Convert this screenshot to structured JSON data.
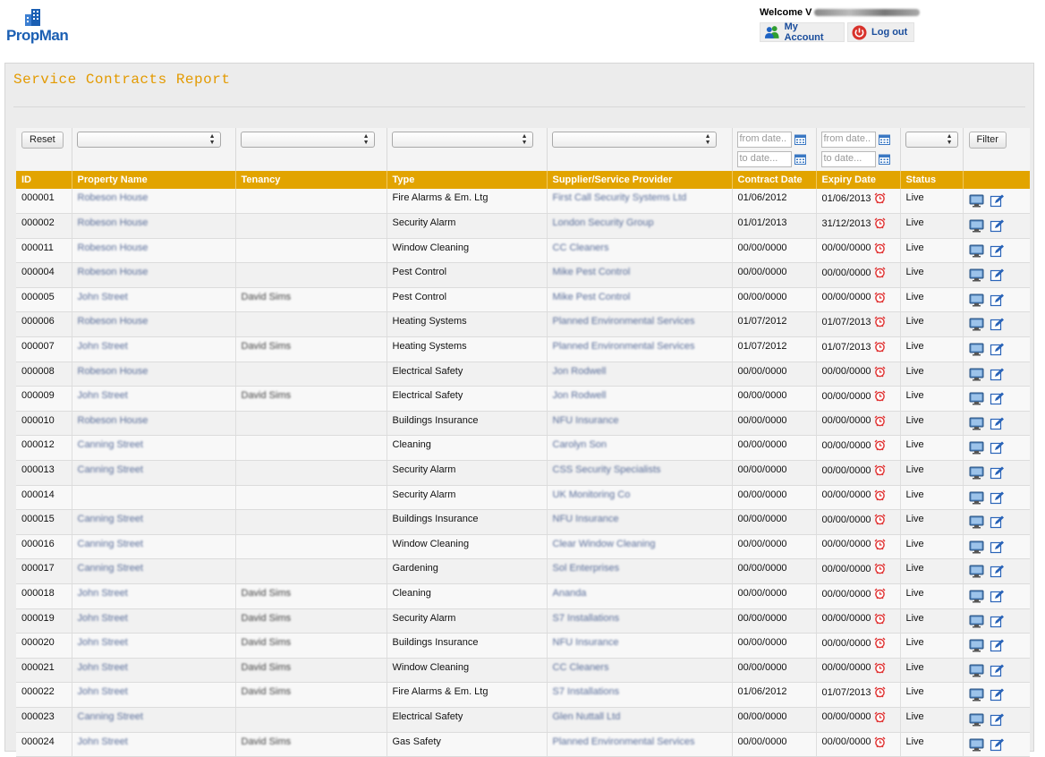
{
  "app": {
    "logo_text": "PropMan"
  },
  "header": {
    "welcome_label": "Welcome V",
    "my_account_label": "My Account",
    "logout_label": "Log out"
  },
  "page": {
    "title": "Service Contracts Report"
  },
  "filters": {
    "reset_label": "Reset",
    "filter_label": "Filter",
    "contract_from_placeholder": "from date..",
    "contract_to_placeholder": "to date...",
    "expiry_from_placeholder": "from date..",
    "expiry_to_placeholder": "to date..."
  },
  "columns": [
    "ID",
    "Property Name",
    "Tenancy",
    "Type",
    "Supplier/Service Provider",
    "Contract Date",
    "Expiry Date",
    "Status",
    ""
  ],
  "rows": [
    {
      "id": "000001",
      "property": "Robeson House",
      "tenancy": "",
      "type": "Fire Alarms & Em. Ltg",
      "supplier": "First Call Security Systems Ltd",
      "contract": "01/06/2012",
      "expiry": "01/06/2013",
      "status": "Live"
    },
    {
      "id": "000002",
      "property": "Robeson House",
      "tenancy": "",
      "type": "Security Alarm",
      "supplier": "London Security Group",
      "contract": "01/01/2013",
      "expiry": "31/12/2013",
      "status": "Live"
    },
    {
      "id": "000011",
      "property": "Robeson House",
      "tenancy": "",
      "type": "Window Cleaning",
      "supplier": "CC Cleaners",
      "contract": "00/00/0000",
      "expiry": "00/00/0000",
      "status": "Live"
    },
    {
      "id": "000004",
      "property": "Robeson House",
      "tenancy": "",
      "type": "Pest Control",
      "supplier": "Mike Pest Control",
      "contract": "00/00/0000",
      "expiry": "00/00/0000",
      "status": "Live"
    },
    {
      "id": "000005",
      "property": "John Street",
      "tenancy": "David Sims",
      "type": "Pest Control",
      "supplier": "Mike Pest Control",
      "contract": "00/00/0000",
      "expiry": "00/00/0000",
      "status": "Live"
    },
    {
      "id": "000006",
      "property": "Robeson House",
      "tenancy": "",
      "type": "Heating Systems",
      "supplier": "Planned Environmental Services",
      "contract": "01/07/2012",
      "expiry": "01/07/2013",
      "status": "Live"
    },
    {
      "id": "000007",
      "property": "John Street",
      "tenancy": "David Sims",
      "type": "Heating Systems",
      "supplier": "Planned Environmental Services",
      "contract": "01/07/2012",
      "expiry": "01/07/2013",
      "status": "Live"
    },
    {
      "id": "000008",
      "property": "Robeson House",
      "tenancy": "",
      "type": "Electrical Safety",
      "supplier": "Jon Rodwell",
      "contract": "00/00/0000",
      "expiry": "00/00/0000",
      "status": "Live"
    },
    {
      "id": "000009",
      "property": "John Street",
      "tenancy": "David Sims",
      "type": "Electrical Safety",
      "supplier": "Jon Rodwell",
      "contract": "00/00/0000",
      "expiry": "00/00/0000",
      "status": "Live"
    },
    {
      "id": "000010",
      "property": "Robeson House",
      "tenancy": "",
      "type": "Buildings Insurance",
      "supplier": "NFU Insurance",
      "contract": "00/00/0000",
      "expiry": "00/00/0000",
      "status": "Live"
    },
    {
      "id": "000012",
      "property": "Canning Street",
      "tenancy": "",
      "type": "Cleaning",
      "supplier": "Carolyn Son",
      "contract": "00/00/0000",
      "expiry": "00/00/0000",
      "status": "Live"
    },
    {
      "id": "000013",
      "property": "Canning Street",
      "tenancy": "",
      "type": "Security Alarm",
      "supplier": "CSS Security Specialists",
      "contract": "00/00/0000",
      "expiry": "00/00/0000",
      "status": "Live"
    },
    {
      "id": "000014",
      "property": "",
      "tenancy": "",
      "type": "Security Alarm",
      "supplier": "UK Monitoring Co",
      "contract": "00/00/0000",
      "expiry": "00/00/0000",
      "status": "Live"
    },
    {
      "id": "000015",
      "property": "Canning Street",
      "tenancy": "",
      "type": "Buildings Insurance",
      "supplier": "NFU Insurance",
      "contract": "00/00/0000",
      "expiry": "00/00/0000",
      "status": "Live"
    },
    {
      "id": "000016",
      "property": "Canning Street",
      "tenancy": "",
      "type": "Window Cleaning",
      "supplier": "Clear Window Cleaning",
      "contract": "00/00/0000",
      "expiry": "00/00/0000",
      "status": "Live"
    },
    {
      "id": "000017",
      "property": "Canning Street",
      "tenancy": "",
      "type": "Gardening",
      "supplier": "Sol Enterprises",
      "contract": "00/00/0000",
      "expiry": "00/00/0000",
      "status": "Live"
    },
    {
      "id": "000018",
      "property": "John Street",
      "tenancy": "David Sims",
      "type": "Cleaning",
      "supplier": "Ananda",
      "contract": "00/00/0000",
      "expiry": "00/00/0000",
      "status": "Live"
    },
    {
      "id": "000019",
      "property": "John Street",
      "tenancy": "David Sims",
      "type": "Security Alarm",
      "supplier": "S7 Installations",
      "contract": "00/00/0000",
      "expiry": "00/00/0000",
      "status": "Live"
    },
    {
      "id": "000020",
      "property": "John Street",
      "tenancy": "David Sims",
      "type": "Buildings Insurance",
      "supplier": "NFU Insurance",
      "contract": "00/00/0000",
      "expiry": "00/00/0000",
      "status": "Live"
    },
    {
      "id": "000021",
      "property": "John Street",
      "tenancy": "David Sims",
      "type": "Window Cleaning",
      "supplier": "CC Cleaners",
      "contract": "00/00/0000",
      "expiry": "00/00/0000",
      "status": "Live"
    },
    {
      "id": "000022",
      "property": "John Street",
      "tenancy": "David Sims",
      "type": "Fire Alarms & Em. Ltg",
      "supplier": "S7 Installations",
      "contract": "01/06/2012",
      "expiry": "01/07/2013",
      "status": "Live"
    },
    {
      "id": "000023",
      "property": "Canning Street",
      "tenancy": "",
      "type": "Electrical Safety",
      "supplier": "Glen Nuttall Ltd",
      "contract": "00/00/0000",
      "expiry": "00/00/0000",
      "status": "Live"
    },
    {
      "id": "000024",
      "property": "John Street",
      "tenancy": "David Sims",
      "type": "Gas Safety",
      "supplier": "Planned Environmental Services",
      "contract": "00/00/0000",
      "expiry": "00/00/0000",
      "status": "Live"
    }
  ],
  "icons": {
    "logo": "building-icon",
    "account": "users-icon",
    "logout": "power-icon",
    "calendar": "calendar-icon",
    "alarm": "alarm-clock-icon",
    "view": "monitor-icon",
    "edit": "edit-icon"
  },
  "colors": {
    "accent": "#e2a400",
    "title": "#e39a00",
    "link": "#1a4d9c",
    "alarm": "#e03030"
  }
}
